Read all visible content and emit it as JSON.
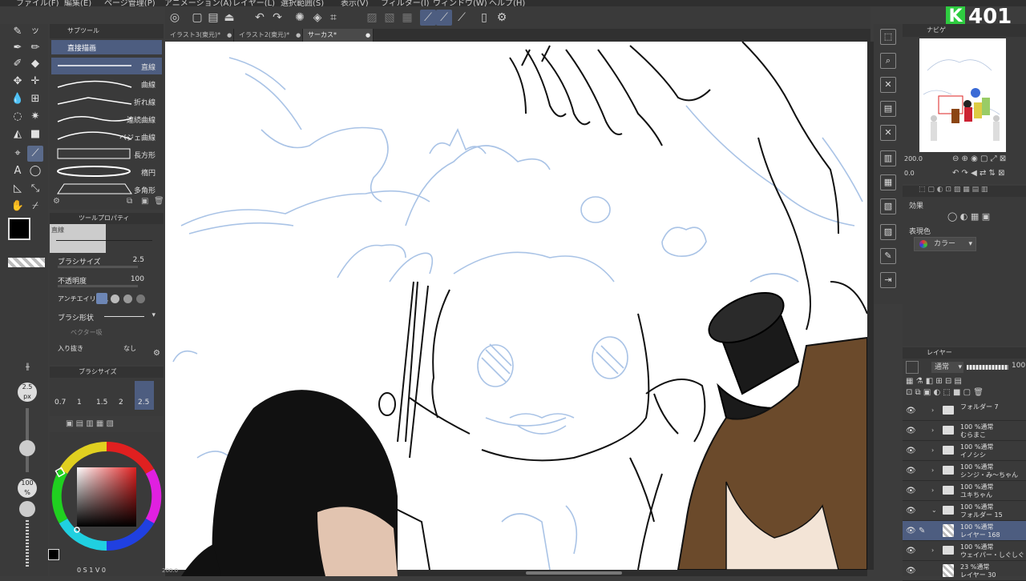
{
  "menu": [
    "ファイル(F)",
    "編集(E)",
    "ページ管理(P)",
    "アニメーション(A)",
    "レイヤー(L)",
    "選択範囲(S)",
    "表示(V)",
    "フィルター(I)",
    "ウィンドウ(W)",
    "ヘルプ(H)"
  ],
  "logo": {
    "letter": "K",
    "number": "401",
    "accent": "#2ecc40"
  },
  "tabs": [
    {
      "label": "イラスト3(東元)*",
      "active": false
    },
    {
      "label": "イラスト2(東元)*",
      "active": false
    },
    {
      "label": "サーカス*",
      "active": true
    }
  ],
  "subtool": {
    "header": "サブツール",
    "selected_label": "直接描画",
    "items": [
      "直線",
      "曲線",
      "折れ線",
      "連続曲線",
      "ベジェ曲線",
      "長方形",
      "楕円",
      "多角形"
    ]
  },
  "tool_property": {
    "header": "ツールプロパティ",
    "preset_label": "直線",
    "brush_size_label": "ブラシサイズ",
    "brush_size_value": "2.5",
    "opacity_label": "不透明度",
    "opacity_value": "100",
    "antialias_label": "アンチエイリアス",
    "brush_shape_label": "ブラシ形状",
    "vector_label": "ベクター吸",
    "taper_label": "入り抜き",
    "taper_value": "なし"
  },
  "brush_size_panel": {
    "header": "ブラシサイズ",
    "sizes": [
      "0.7",
      "1",
      "1.5",
      "2",
      "2.5"
    ],
    "selected": "2.5"
  },
  "left_indicator": {
    "size": "2.5",
    "unit": "px",
    "opacity": "100",
    "opacity_unit": "%"
  },
  "bottom_left_readout": "0 S 1 V 0",
  "canvas_zoom": "200.0",
  "navigator": {
    "header": "ナビゲ",
    "zoom": "200.0",
    "angle": "0.0"
  },
  "effects": {
    "label": "効果",
    "display_color_label": "表現色",
    "display_color_value": "カラー"
  },
  "layers": {
    "header": "レイヤー",
    "blend_mode": "通常",
    "opacity": "100",
    "rows": [
      {
        "line1": "フォルダー 7",
        "line2": "",
        "folder": true,
        "expanded": false,
        "selected": false
      },
      {
        "line1": "100 %通常",
        "line2": "むらまこ",
        "folder": true,
        "expanded": false,
        "selected": false
      },
      {
        "line1": "100 %通常",
        "line2": "イノシシ",
        "folder": true,
        "expanded": false,
        "selected": false
      },
      {
        "line1": "100 %通常",
        "line2": "シンジ・み～ちゃん",
        "folder": true,
        "expanded": false,
        "selected": false
      },
      {
        "line1": "100 %通常",
        "line2": "ユキちゃん",
        "folder": true,
        "expanded": false,
        "selected": false
      },
      {
        "line1": "100 %通常",
        "line2": "フォルダー 15",
        "folder": true,
        "expanded": true,
        "selected": false
      },
      {
        "line1": "100 %通常",
        "line2": "レイヤー 168",
        "folder": false,
        "expanded": false,
        "selected": true
      },
      {
        "line1": "100 %通常",
        "line2": "ウェイパー・しぐしぐ",
        "folder": true,
        "expanded": false,
        "selected": false
      },
      {
        "line1": "23 %通常",
        "line2": "レイヤー 30",
        "folder": false,
        "expanded": false,
        "selected": false
      }
    ]
  },
  "colors": {
    "accent": "#2ecc40",
    "selection": "#4d5d80",
    "panel": "#3a3a3a",
    "sketch_blue": "#a9c3e6",
    "main_color": "#000000"
  }
}
